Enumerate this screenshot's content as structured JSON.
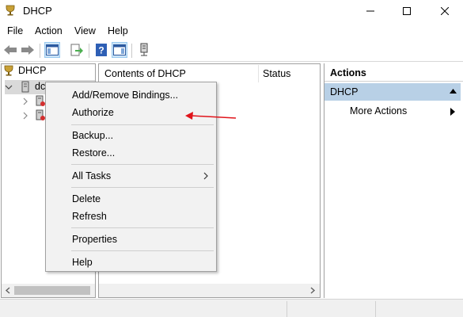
{
  "window": {
    "title": "DHCP",
    "min_icon": "minimize-icon",
    "max_icon": "maximize-icon",
    "close_icon": "close-icon"
  },
  "menubar": [
    "File",
    "Action",
    "View",
    "Help"
  ],
  "toolbar": {
    "icons": [
      "back-arrow-icon",
      "forward-arrow-icon",
      "show-hide-console-tree-icon",
      "export-list-icon",
      "help-icon",
      "show-hide-action-pane-icon",
      "server-plug-icon"
    ]
  },
  "tree": {
    "root": "DHCP",
    "server_label": "dc",
    "child_icons": [
      "server-node-icon",
      "server-node-icon"
    ]
  },
  "list": {
    "columns": [
      "Contents of DHCP",
      "Status"
    ]
  },
  "actions": {
    "title": "Actions",
    "section": "DHCP",
    "more": "More Actions"
  },
  "context_menu": {
    "items": [
      {
        "label": "Add/Remove Bindings..."
      },
      {
        "label": "Authorize"
      },
      {
        "label": "Backup..."
      },
      {
        "label": "Restore..."
      },
      {
        "label": "All Tasks",
        "submenu": true
      },
      {
        "label": "Delete"
      },
      {
        "label": "Refresh"
      },
      {
        "label": "Properties"
      },
      {
        "label": "Help"
      }
    ]
  },
  "annotation": {
    "arrow_color": "#e0141b",
    "points_to": "Authorize"
  },
  "colors": {
    "selection": "#b8d0e6",
    "menu_bg": "#f2f2f2"
  }
}
